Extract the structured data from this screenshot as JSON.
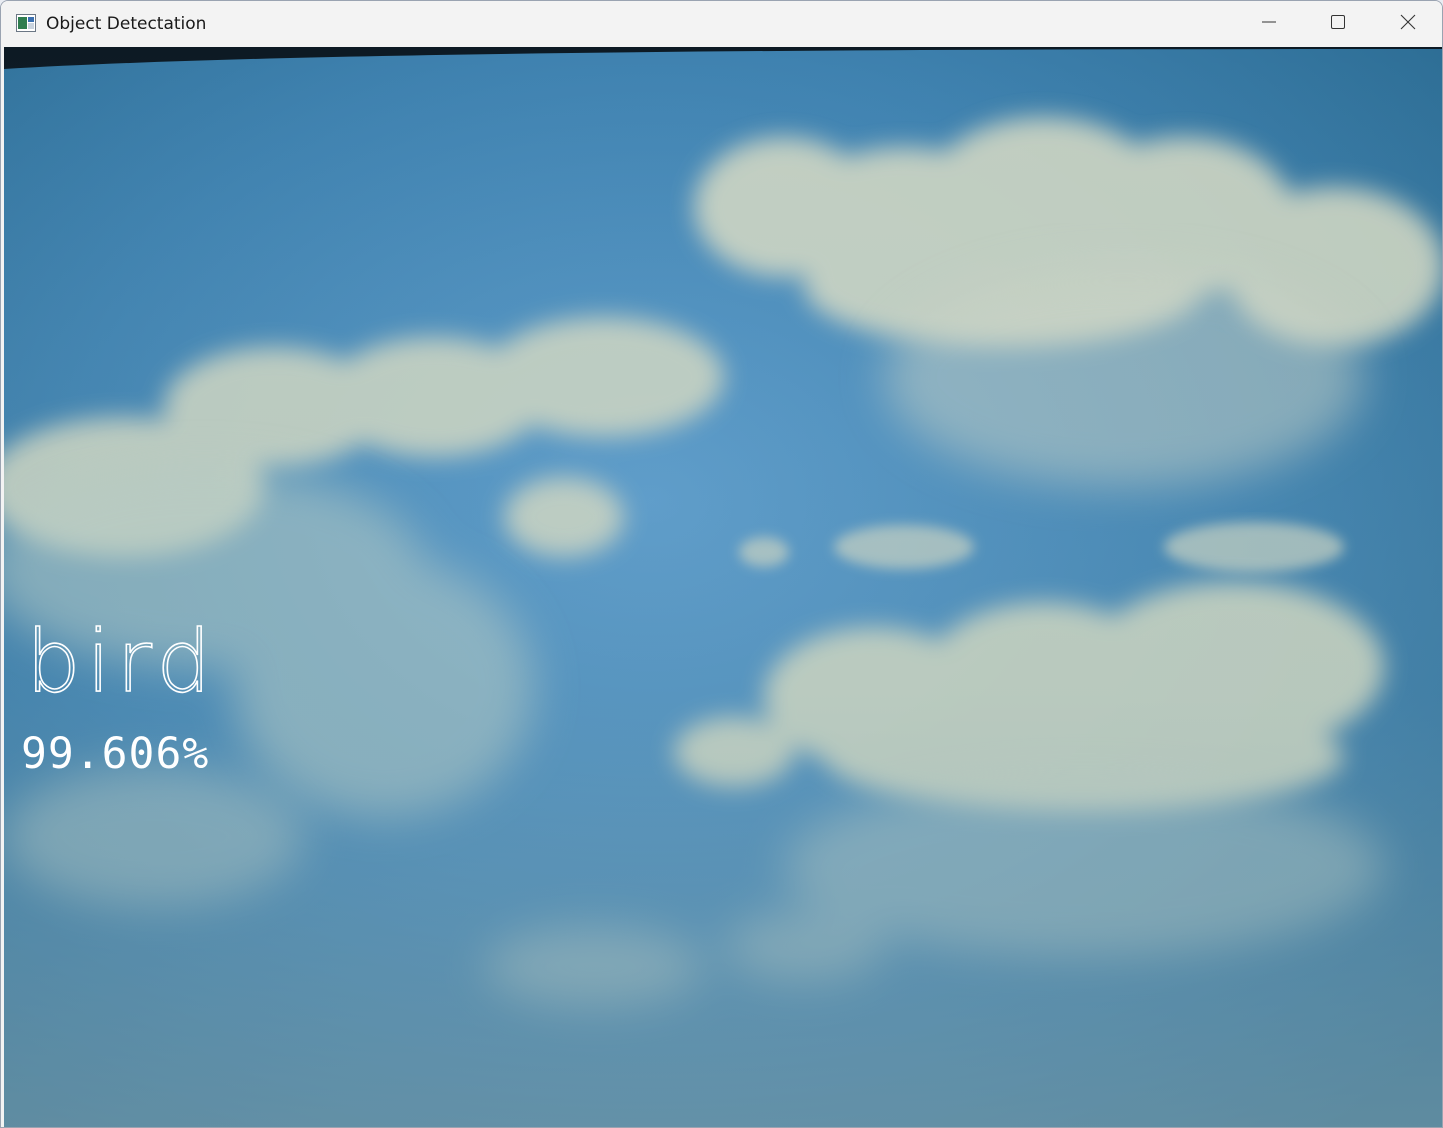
{
  "window": {
    "title": "Object Detectation",
    "icons": {
      "app": "app-window-icon",
      "minimize": "minimize-icon",
      "maximize": "maximize-icon",
      "close": "close-icon"
    }
  },
  "detection": {
    "label": "bird",
    "confidence": "99.606%"
  },
  "colors": {
    "titlebar": "#f3f3f3",
    "overlay_text": "#ffffff",
    "sky_center": "#5b9bc8",
    "sky_edge": "#2f6f97"
  }
}
